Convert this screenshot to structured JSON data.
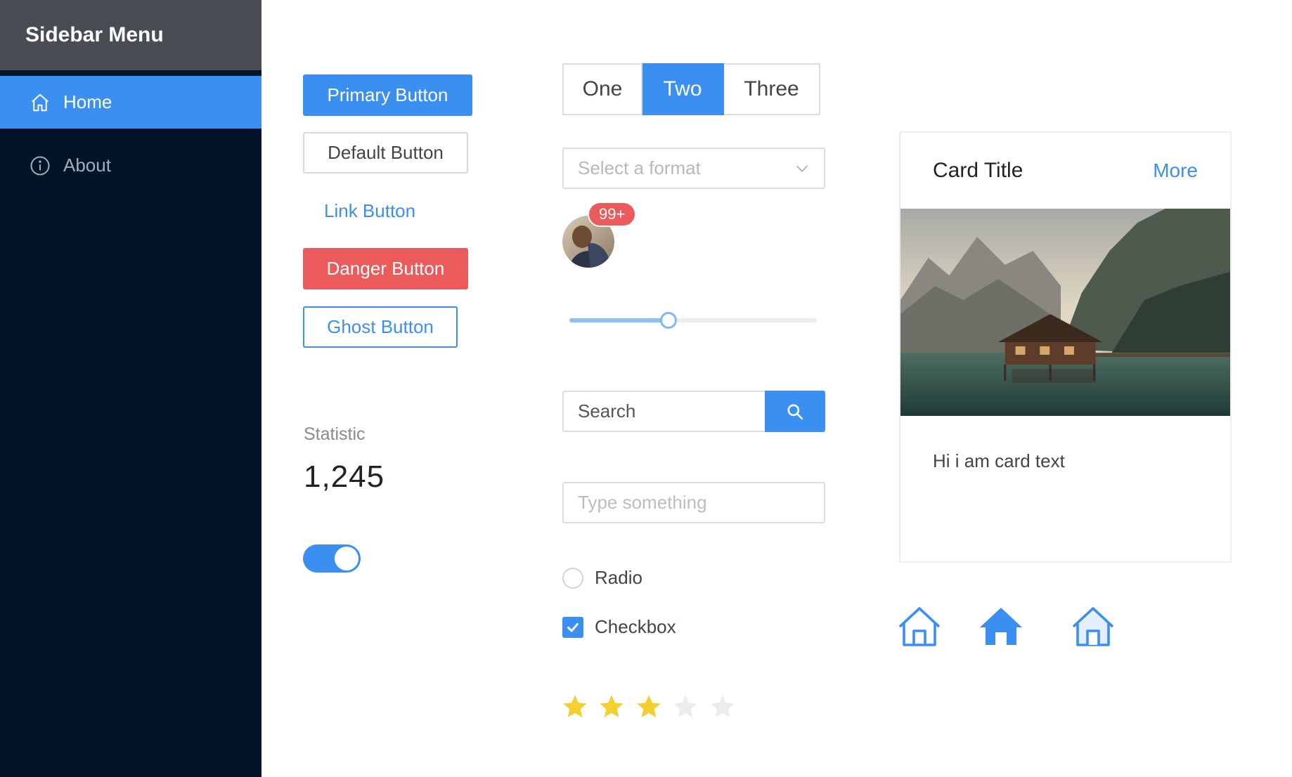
{
  "sidebar": {
    "title": "Sidebar Menu",
    "items": [
      {
        "label": "Home",
        "icon": "home-icon",
        "active": true
      },
      {
        "label": "About",
        "icon": "info-icon",
        "active": false
      }
    ]
  },
  "buttons": {
    "primary": "Primary Button",
    "default": "Default Button",
    "link": "Link Button",
    "danger": "Danger Button",
    "ghost": "Ghost Button"
  },
  "statistic": {
    "title": "Statistic",
    "value": "1,245"
  },
  "switch": {
    "checked": true
  },
  "segmented": {
    "options": [
      "One",
      "Two",
      "Three"
    ],
    "selected": "Two"
  },
  "select": {
    "placeholder": "Select a format"
  },
  "badge": {
    "count": "99+"
  },
  "slider": {
    "value": 0.4
  },
  "search": {
    "placeholder": "Search"
  },
  "text_input": {
    "placeholder": "Type something"
  },
  "radio": {
    "label": "Radio",
    "checked": false
  },
  "checkbox": {
    "label": "Checkbox",
    "checked": true
  },
  "rating": {
    "value": 3,
    "max": 5
  },
  "card": {
    "title": "Card Title",
    "more": "More",
    "text": "Hi i am card text"
  },
  "icons": [
    "home-outline-icon",
    "home-filled-icon",
    "home-two-tone-icon"
  ],
  "colors": {
    "primary": "#3a8ff1",
    "danger": "#ec5b5b",
    "sidebar_bg": "#021528",
    "sidebar_header": "#494d53",
    "star": "#f5cf2f"
  }
}
